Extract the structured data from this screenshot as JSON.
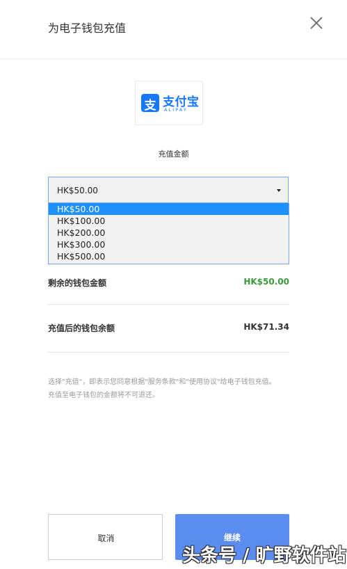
{
  "header": {
    "title": "为电子钱包充值"
  },
  "brand": {
    "name_cn": "支付宝",
    "name_en": "ALIPAY",
    "mark_char": "支",
    "color": "#1677ff"
  },
  "amount": {
    "label": "充值金额",
    "selected": "HK$50.00",
    "options": [
      "HK$50.00",
      "HK$100.00",
      "HK$200.00",
      "HK$300.00",
      "HK$500.00"
    ]
  },
  "summary": {
    "remaining_label": "剩余的钱包金额",
    "remaining_value": "HK$50.00",
    "remaining_color": "#3a9a3a",
    "after_label": "充值后的钱包余额",
    "after_value": "HK$71.34"
  },
  "terms": {
    "line1": "选择\"充值\"，即表示您同意根据\"服务条款\"和\"使用协议\"给电子钱包充值。",
    "line2": "充值至电子钱包的金额将不可退还。"
  },
  "buttons": {
    "cancel": "取消",
    "continue": "继续",
    "continue_color": "#5b8cf0"
  },
  "watermark": "头条号 / 旷野软件站",
  "icons": {
    "close": "close-icon",
    "caret": "caret-down-icon"
  }
}
